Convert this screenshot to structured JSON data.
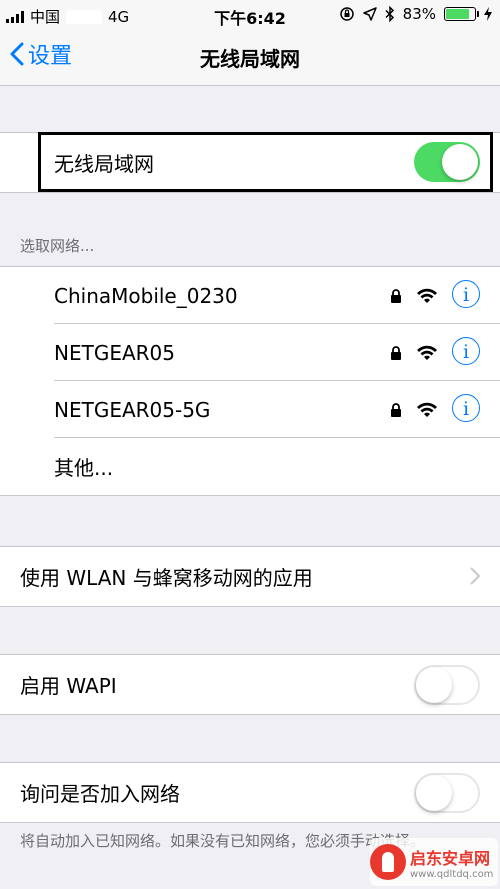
{
  "status_bar": {
    "carrier": "中国",
    "network": "4G",
    "time": "下午6:42",
    "battery": "83%",
    "battery_level": 0.83
  },
  "nav": {
    "back_label": "设置",
    "title": "无线局域网"
  },
  "wlan_toggle": {
    "label": "无线局域网",
    "on": true
  },
  "networks": {
    "header": "选取网络...",
    "items": [
      {
        "name": "ChinaMobile_0230",
        "secured": true
      },
      {
        "name": "NETGEAR05",
        "secured": true
      },
      {
        "name": "NETGEAR05-5G",
        "secured": true
      }
    ],
    "other_label": "其他..."
  },
  "apps_row": {
    "label": "使用 WLAN 与蜂窝移动网的应用"
  },
  "wapi": {
    "label": "启用 WAPI",
    "on": false
  },
  "ask_join": {
    "label": "询问是否加入网络",
    "on": false,
    "footer": "将自动加入已知网络。如果没有已知网络，您必须手动选择。"
  },
  "watermark": {
    "title": "启东安卓网",
    "url": "www.qdltdq.com"
  },
  "colors": {
    "accent": "#007aff",
    "toggle_on": "#4cd964",
    "background": "#efeff4"
  }
}
